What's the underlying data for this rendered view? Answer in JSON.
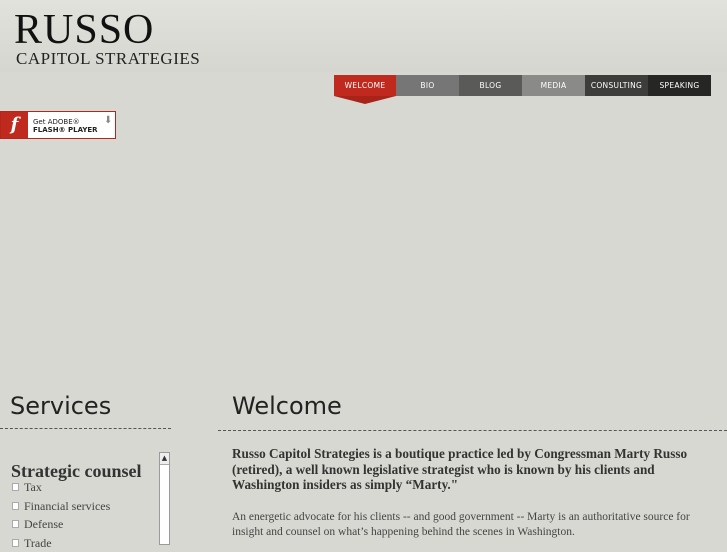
{
  "header": {
    "logo_main": "RUSSO",
    "logo_sub": "CAPITOL STRATEGIES"
  },
  "nav": {
    "items": [
      {
        "label": "WELCOME",
        "color": "#c0291d",
        "active": true
      },
      {
        "label": "BIO",
        "color": "#767676"
      },
      {
        "label": "BLOG",
        "color": "#5a5a58"
      },
      {
        "label": "MEDIA",
        "color": "#8a8a88"
      },
      {
        "label": "CONSULTING",
        "color": "#3d3d3b"
      },
      {
        "label": "SPEAKING",
        "color": "#262625"
      }
    ]
  },
  "flash": {
    "line1": "Get ADOBE®",
    "line2": "FLASH® PLAYER",
    "icon": "flash-player-icon"
  },
  "services": {
    "title": "Services",
    "category": "Strategic counsel",
    "items": [
      "Tax",
      "Financial services",
      "Defense",
      "Trade"
    ]
  },
  "welcome": {
    "title": "Welcome",
    "intro_bold": "Russo Capitol Strategies is a boutique practice led by Congressman Marty Russo (retired), a well known legislative strategist who is known by his clients and Washington insiders as simply “Marty.\"",
    "intro_normal": "An energetic advocate for his clients -- and good government --  Marty is an authoritative source for insight and counsel on what’s happening behind the scenes in Washington."
  },
  "colors": {
    "accent": "#c0291d",
    "background": "#d8d8d2"
  }
}
